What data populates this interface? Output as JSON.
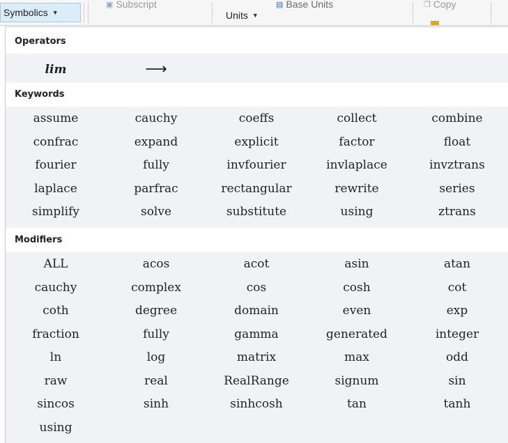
{
  "ribbon": {
    "symbolics_label": "Symbolics",
    "subscript_label": "Subscript",
    "units_label": "Units",
    "base_units_label": "Base Units",
    "copy_label": "Copy"
  },
  "popup": {
    "operators": {
      "title": "Operators",
      "items": [
        "lim",
        "⟶"
      ]
    },
    "keywords": {
      "title": "Keywords",
      "rows": [
        [
          "assume",
          "cauchy",
          "coeffs",
          "collect",
          "combine"
        ],
        [
          "confrac",
          "expand",
          "explicit",
          "factor",
          "float"
        ],
        [
          "fourier",
          "fully",
          "invfourier",
          "invlaplace",
          "invztrans"
        ],
        [
          "laplace",
          "parfrac",
          "rectangular",
          "rewrite",
          "series"
        ],
        [
          "simplify",
          "solve",
          "substitute",
          "using",
          "ztrans"
        ]
      ]
    },
    "modifiers": {
      "title": "Modifiers",
      "rows": [
        [
          "ALL",
          "acos",
          "acot",
          "asin",
          "atan"
        ],
        [
          "cauchy",
          "complex",
          "cos",
          "cosh",
          "cot"
        ],
        [
          "coth",
          "degree",
          "domain",
          "even",
          "exp"
        ],
        [
          "fraction",
          "fully",
          "gamma",
          "generated",
          "integer"
        ],
        [
          "ln",
          "log",
          "matrix",
          "max",
          "odd"
        ],
        [
          "raw",
          "real",
          "RealRange",
          "signum",
          "sin"
        ],
        [
          "sincos",
          "sinh",
          "sinhcosh",
          "tan",
          "tanh"
        ],
        [
          "using"
        ]
      ]
    }
  }
}
